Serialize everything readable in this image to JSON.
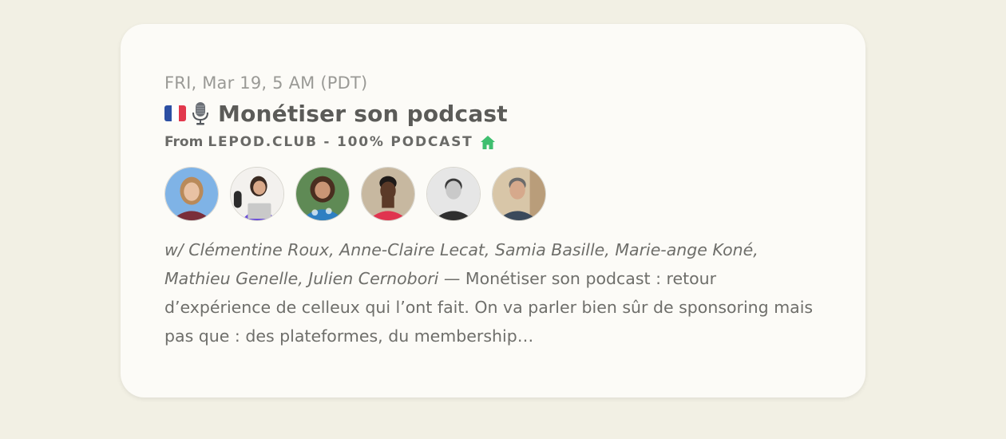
{
  "event": {
    "date": "FRI, Mar 19, 5 AM (PDT)",
    "title": "Monétiser son podcast",
    "from_label": "From",
    "organizer": "LEPOD.CLUB - 100% PODCAST",
    "title_icons": [
      "france-flag-icon",
      "microphone-icon"
    ],
    "organizer_icon": "house-icon",
    "guests_text": "w/ Clémentine Roux, Anne-Claire Lecat, Samia Basille, Marie-ange Koné, Mathieu Genelle, Julien Cernobori",
    "separator": " — ",
    "description": "Monétiser son podcast : retour d’expérience de celleux qui l’ont fait. On va parler bien sûr de sponsoring mais pas que : des plateformes, du membership…"
  },
  "colors": {
    "background": "#f2f0e4",
    "card": "#fcfbf7",
    "house_icon": "#3fbf6f"
  }
}
